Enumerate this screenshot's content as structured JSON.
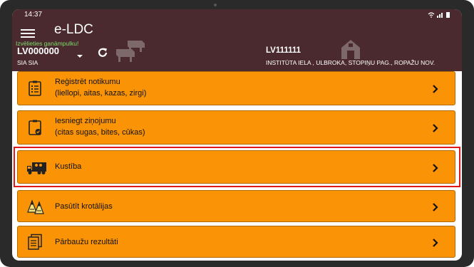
{
  "status_bar": {
    "time": "14:37",
    "icons": "wifi-signal-battery"
  },
  "app": {
    "title": "e-LDC"
  },
  "herd": {
    "hint": "Izvēlieties ganāmpulku!",
    "id": "LV000000",
    "owner": "SIA SIA"
  },
  "farm": {
    "id": "LV111111",
    "address": "INSTITŪTA IELA , ULBROKA, STOPIŅU PAG., ROPAŽU NOV."
  },
  "menu": [
    {
      "line1": "Reģistrēt notikumu",
      "line2": "(liellopi, aitas, kazas, zirgi)",
      "icon": "register-list-icon"
    },
    {
      "line1": "Iesniegt ziņojumu",
      "line2": "(citas sugas, bites, cūkas)",
      "icon": "clipboard-check-icon"
    },
    {
      "line1": "Kustība",
      "line2": "",
      "icon": "livestock-truck-icon",
      "highlighted": true
    },
    {
      "line1": "Pasūtīt krotālijas",
      "line2": "",
      "icon": "ear-tags-icon"
    },
    {
      "line1": "Pārbaužu rezultāti",
      "line2": "",
      "icon": "documents-icon"
    }
  ],
  "colors": {
    "appbar": "#4a2a2f",
    "item_bg": "#fa9406",
    "highlight": "#e01818",
    "hint": "#7ddc6a"
  }
}
